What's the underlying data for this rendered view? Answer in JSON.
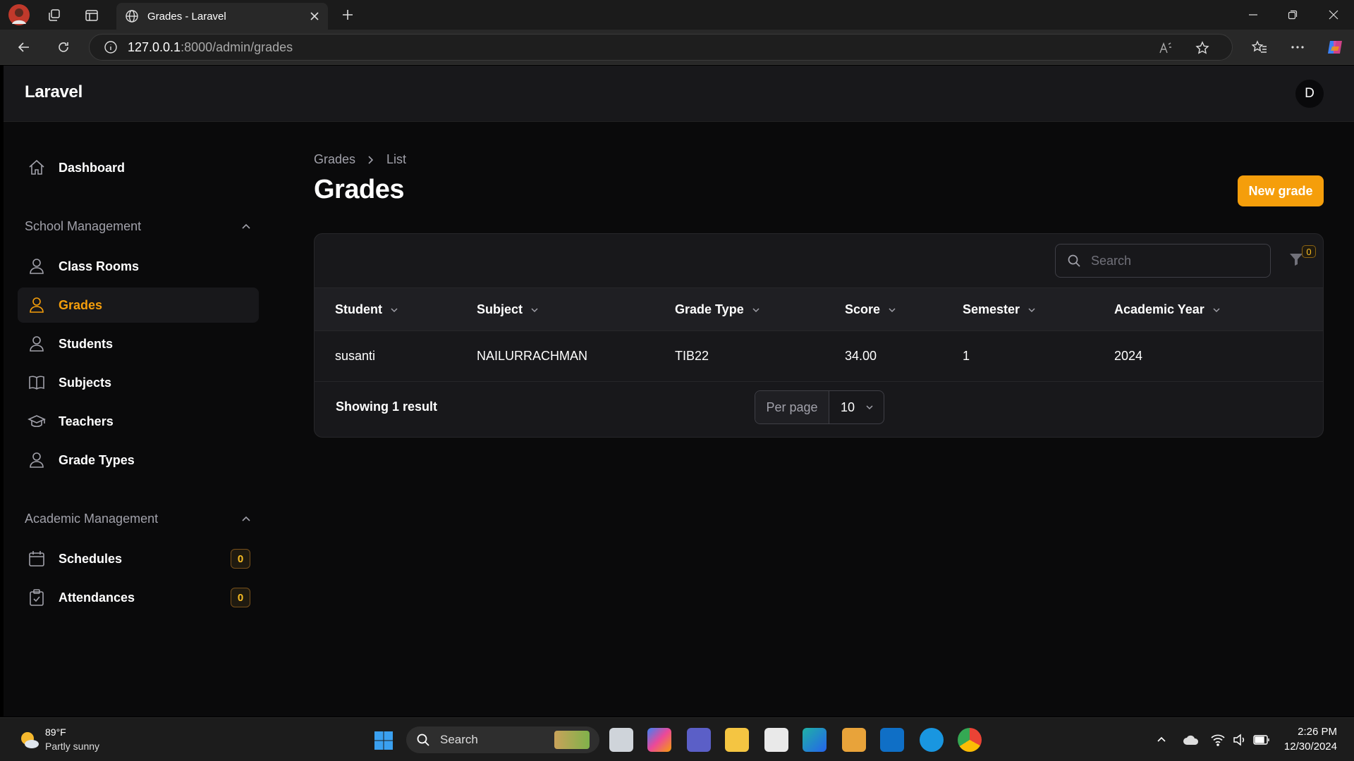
{
  "browser": {
    "tab_title": "Grades - Laravel",
    "url_host": "127.0.0.1",
    "url_path": ":8000/admin/grades"
  },
  "app": {
    "brand": "Laravel",
    "avatar_initial": "D"
  },
  "sidebar": {
    "dashboard": "Dashboard",
    "groups": [
      {
        "label": "School Management",
        "items": [
          "Class Rooms",
          "Grades",
          "Students",
          "Subjects",
          "Teachers",
          "Grade Types"
        ]
      },
      {
        "label": "Academic Management",
        "items": [
          "Schedules",
          "Attendances"
        ]
      }
    ],
    "badges": {
      "schedules": "0",
      "attendances": "0"
    },
    "active_item": "Grades"
  },
  "page": {
    "breadcrumb": [
      "Grades",
      "List"
    ],
    "title": "Grades",
    "new_button": "New grade"
  },
  "table": {
    "search_placeholder": "Search",
    "filter_count": "0",
    "columns": [
      "Student",
      "Subject",
      "Grade Type",
      "Score",
      "Semester",
      "Academic Year"
    ],
    "rows": [
      [
        "susanti",
        "NAILURRACHMAN",
        "TIB22",
        "34.00",
        "1",
        "2024"
      ]
    ],
    "showing": "Showing 1 result",
    "per_page_label": "Per page",
    "per_page_value": "10"
  },
  "taskbar": {
    "weather_temp": "89°F",
    "weather_desc": "Partly sunny",
    "search": "Search",
    "time": "2:26 PM",
    "date": "12/30/2024"
  },
  "colors": {
    "accent": "#f59e0b",
    "background": "#0a0a0b",
    "panel": "#18181b"
  }
}
